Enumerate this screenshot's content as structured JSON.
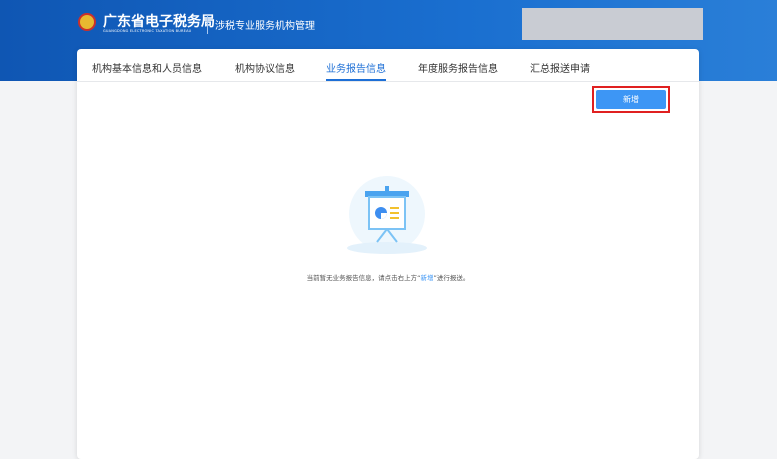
{
  "header": {
    "title": "广东省电子税务局",
    "title_en": "GUANGDONG ELECTRONIC TAXATION BUREAU",
    "subtitle": "涉税专业服务机构管理"
  },
  "tabs": [
    {
      "label": "机构基本信息和人员信息"
    },
    {
      "label": "机构协议信息"
    },
    {
      "label": "业务报告信息",
      "active": true
    },
    {
      "label": "年度服务报告信息"
    },
    {
      "label": "汇总报送申请"
    }
  ],
  "add_button": "新增",
  "empty": {
    "before": "当前暂无业务报告信息，请点击右上方“",
    "link": "新增",
    "after": "”进行报送。"
  },
  "colors": {
    "header": "#1a6fd0",
    "accent": "#3d96f5",
    "highlight": "#e02020"
  }
}
